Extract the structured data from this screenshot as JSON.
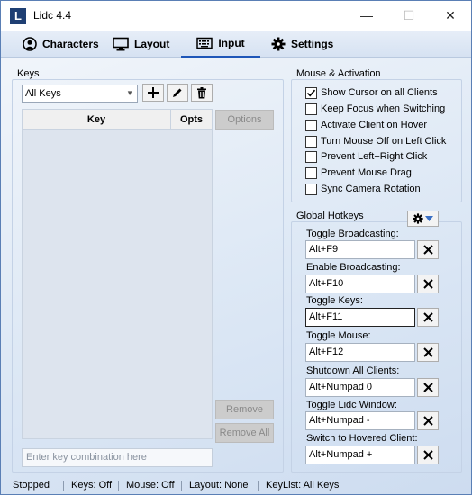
{
  "window": {
    "title": "Lidc 4.4",
    "icon_letter": "L",
    "controls": {
      "minimize": "—",
      "maximize": "☐",
      "close": "✕"
    }
  },
  "tabs": [
    {
      "label": "Characters",
      "icon": "user-circle-icon",
      "active": false
    },
    {
      "label": "Layout",
      "icon": "monitor-icon",
      "active": false
    },
    {
      "label": "Input",
      "icon": "keyboard-icon",
      "active": true
    },
    {
      "label": "Settings",
      "icon": "gear-icon",
      "active": false
    }
  ],
  "keys": {
    "group_label": "Keys",
    "filter_selected": "All Keys",
    "tools": [
      "add-icon",
      "edit-pencil-icon",
      "delete-trash-icon"
    ],
    "columns": [
      "Key",
      "Opts"
    ],
    "options_button": "Options",
    "remove_button": "Remove",
    "remove_all_button": "Remove All",
    "combo_placeholder": "Enter key combination here"
  },
  "mouse": {
    "group_label": "Mouse & Activation",
    "options": [
      {
        "label": "Show Cursor on all Clients",
        "checked": true
      },
      {
        "label": "Keep Focus when Switching",
        "checked": false
      },
      {
        "label": "Activate Client on Hover",
        "checked": false
      },
      {
        "label": "Turn Mouse Off on Left Click",
        "checked": false
      },
      {
        "label": "Prevent Left+Right Click",
        "checked": false
      },
      {
        "label": "Prevent Mouse Drag",
        "checked": false
      },
      {
        "label": "Sync Camera Rotation",
        "checked": false
      }
    ]
  },
  "hotkeys": {
    "group_label": "Global Hotkeys",
    "items": [
      {
        "label": "Toggle Broadcasting:",
        "value": "Alt+F9"
      },
      {
        "label": "Enable Broadcasting:",
        "value": "Alt+F10"
      },
      {
        "label": "Toggle Keys:",
        "value": "Alt+F11"
      },
      {
        "label": "Toggle Mouse:",
        "value": "Alt+F12"
      },
      {
        "label": "Shutdown All Clients:",
        "value": "Alt+Numpad 0"
      },
      {
        "label": "Toggle Lidc Window:",
        "value": "Alt+Numpad -"
      },
      {
        "label": "Switch to Hovered Client:",
        "value": "Alt+Numpad +"
      }
    ]
  },
  "status": {
    "state": "Stopped",
    "keys": "Keys: Off",
    "mouse": "Mouse: Off",
    "layout": "Layout: None",
    "keylist": "KeyList: All Keys"
  },
  "colors": {
    "accent": "#1e56b8",
    "icon_dark": "#1f3f73"
  }
}
